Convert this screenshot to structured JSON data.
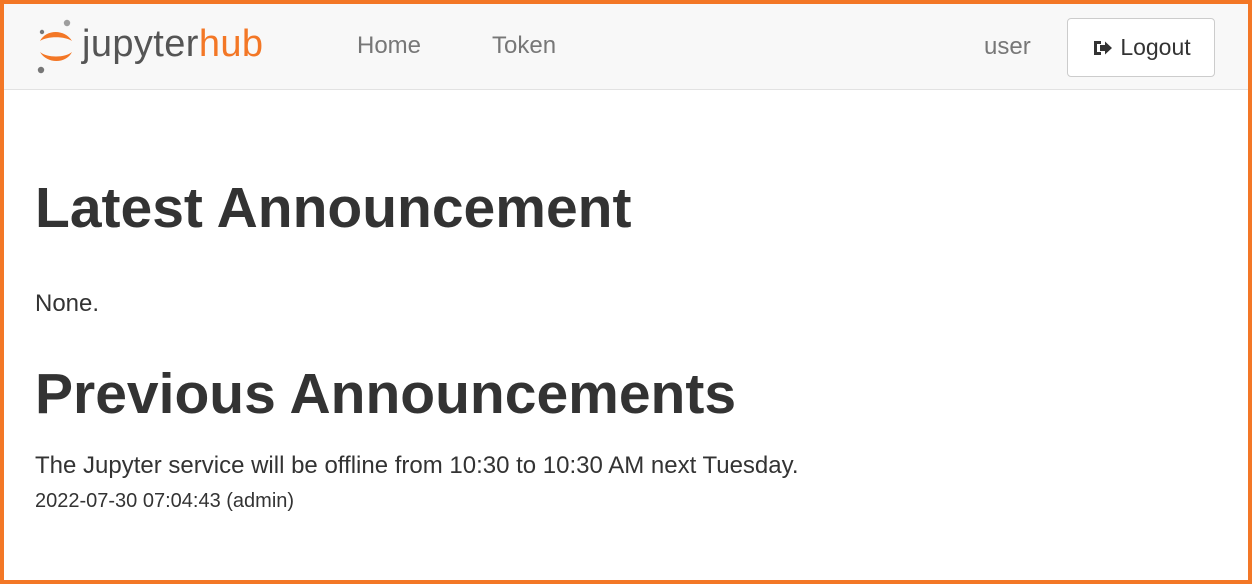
{
  "header": {
    "brand": {
      "primary": "jupyter",
      "secondary": "hub",
      "icon": "jupyter-logo-icon"
    },
    "nav": [
      {
        "label": "Home"
      },
      {
        "label": "Token"
      }
    ],
    "user": "user",
    "logout": {
      "label": "Logout",
      "icon": "logout-icon"
    }
  },
  "main": {
    "latest": {
      "title": "Latest Announcement",
      "message": "None."
    },
    "previous": {
      "title": "Previous Announcements",
      "items": [
        {
          "message": "The Jupyter service will be offline from 10:30 to 10:30 AM next Tuesday.",
          "meta": "2022-07-30 07:04:43 (admin)"
        }
      ]
    }
  },
  "colors": {
    "accent": "#f37726",
    "nav_background": "#f8f8f8",
    "text": "#333333",
    "muted_text": "#777777"
  }
}
